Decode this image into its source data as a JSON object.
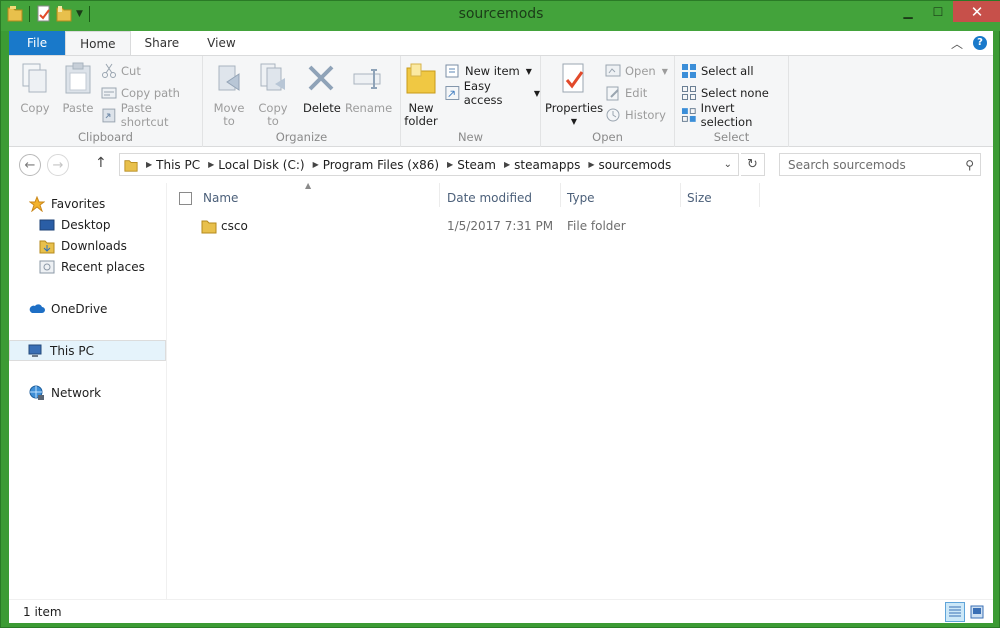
{
  "window": {
    "title": "sourcemods"
  },
  "tabs": {
    "file": "File",
    "home": "Home",
    "share": "Share",
    "view": "View"
  },
  "ribbon": {
    "clipboard": {
      "label": "Clipboard",
      "copy": "Copy",
      "paste": "Paste",
      "cut": "Cut",
      "copy_path": "Copy path",
      "paste_shortcut": "Paste shortcut"
    },
    "organize": {
      "label": "Organize",
      "move_to": "Move to",
      "copy_to": "Copy to",
      "delete": "Delete",
      "rename": "Rename"
    },
    "new": {
      "label": "New",
      "new_folder_1": "New",
      "new_folder_2": "folder",
      "new_item": "New item",
      "easy_access": "Easy access"
    },
    "open": {
      "label": "Open",
      "properties": "Properties",
      "open": "Open",
      "edit": "Edit",
      "history": "History"
    },
    "select": {
      "label": "Select",
      "select_all": "Select all",
      "select_none": "Select none",
      "invert_selection": "Invert selection"
    }
  },
  "address": {
    "crumbs": [
      "This PC",
      "Local Disk (C:)",
      "Program Files (x86)",
      "Steam",
      "steamapps",
      "sourcemods"
    ]
  },
  "search": {
    "placeholder": "Search sourcemods"
  },
  "nav_pane": {
    "items": [
      {
        "label": "Favorites",
        "icon": "star-icon"
      },
      {
        "label": "Desktop",
        "icon": "desktop-icon"
      },
      {
        "label": "Downloads",
        "icon": "downloads-folder-icon"
      },
      {
        "label": "Recent places",
        "icon": "recent-places-icon"
      },
      {
        "label": "OneDrive",
        "icon": "cloud-icon"
      },
      {
        "label": "This PC",
        "icon": "computer-icon"
      },
      {
        "label": "Network",
        "icon": "network-icon"
      }
    ]
  },
  "columns": {
    "name": "Name",
    "date_modified": "Date modified",
    "type": "Type",
    "size": "Size"
  },
  "files": [
    {
      "name": "csco",
      "date_modified": "1/5/2017 7:31 PM",
      "type": "File folder",
      "size": ""
    }
  ],
  "status": {
    "item_count": "1 item"
  },
  "colors": {
    "accent": "#1979ca",
    "titlebar": "#43a33b",
    "close": "#c7504a"
  }
}
